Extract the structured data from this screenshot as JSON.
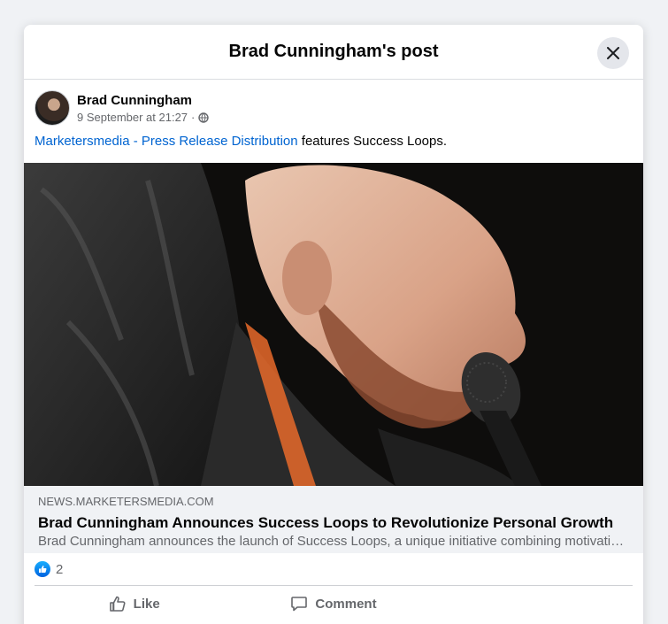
{
  "modal": {
    "title": "Brad Cunningham's post"
  },
  "post": {
    "author": "Brad Cunningham",
    "timestamp": "9 September at 21:27",
    "separator": "·",
    "visibility_icon": "globe-icon",
    "text_link": "Marketersmedia - Press Release Distribution",
    "text_rest": " features Success Loops."
  },
  "link_preview": {
    "domain": "NEWS.MARKETERSMEDIA.COM",
    "title": "Brad Cunningham Announces Success Loops to Revolutionize Personal Growth",
    "description": "Brad Cunningham announces the launch of Success Loops, a unique initiative combining motivation, mindset and personal development strategies for growth"
  },
  "reactions": {
    "count": "2",
    "icon": "like-icon"
  },
  "actions": {
    "like_label": "Like",
    "comment_label": "Comment"
  },
  "colors": {
    "link": "#0064d1",
    "reaction_blue": "#0866ff",
    "secondary_text": "#65676b",
    "background": "#f0f2f5"
  }
}
